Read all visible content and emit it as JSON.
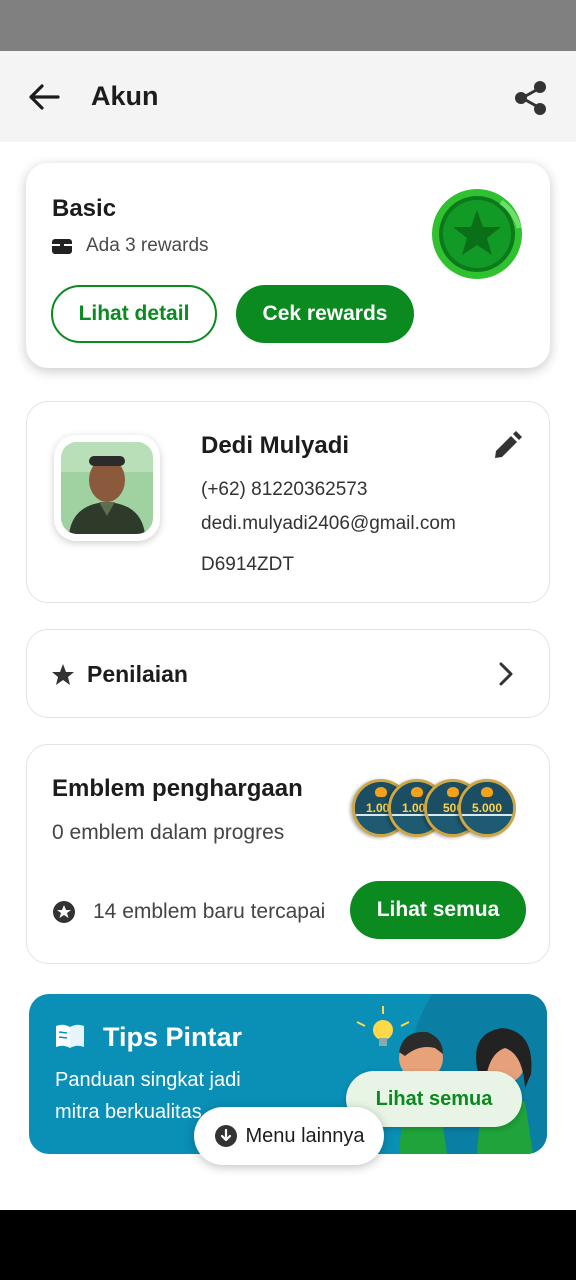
{
  "header": {
    "title": "Akun"
  },
  "membership": {
    "tier": "Basic",
    "rewards_text": "Ada 3 rewards",
    "detail_button": "Lihat detail",
    "rewards_button": "Cek rewards"
  },
  "profile": {
    "name": "Dedi Mulyadi",
    "phone": "(+62) 81220362573",
    "email": "dedi.mulyadi2406@gmail.com",
    "plate": "D6914ZDT"
  },
  "rating": {
    "label": "Penilaian"
  },
  "badges": {
    "title": "Emblem penghargaan",
    "progress_text": "0 emblem dalam progres",
    "achieved_text": "14 emblem baru tercapai",
    "see_all_button": "Lihat semua",
    "coins": [
      "1.000",
      "1.000",
      "500",
      "5.000"
    ]
  },
  "tips": {
    "title": "Tips Pintar",
    "subtitle_line1": "Panduan singkat jadi",
    "subtitle_line2": "mitra berkualitas",
    "button": "Lihat semua"
  },
  "more_menu": {
    "label": "Menu lainnya"
  },
  "colors": {
    "brand_green": "#0a8a1f",
    "tips_blue": "#0a8fb6"
  }
}
